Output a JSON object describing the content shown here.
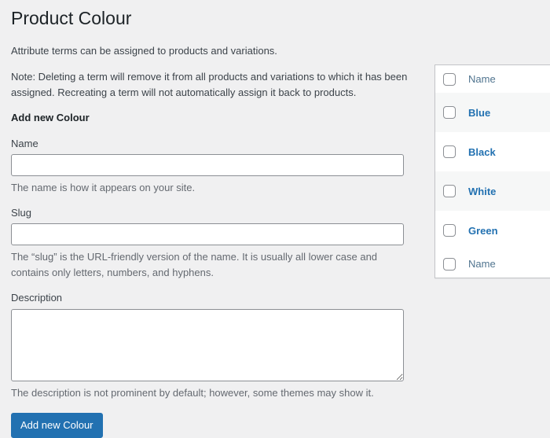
{
  "page": {
    "title": "Product Colour",
    "intro": "Attribute terms can be assigned to products and variations.",
    "note": "Note: Deleting a term will remove it from all products and variations to which it has been assigned. Recreating a term will not automatically assign it back to products.",
    "section_heading": "Add new Colour",
    "background_color": "#f0f0f1"
  },
  "form": {
    "name": {
      "label": "Name",
      "value": "",
      "placeholder": "",
      "help": "The name is how it appears on your site."
    },
    "slug": {
      "label": "Slug",
      "value": "",
      "placeholder": "",
      "help": "The “slug” is the URL-friendly version of the name. It is usually all lower case and contains only letters, numbers, and hyphens."
    },
    "description": {
      "label": "Description",
      "value": "",
      "placeholder": "",
      "help": "The description is not prominent by default; however, some themes may show it."
    },
    "submit": {
      "label": "Add new Colour",
      "color": "#2271b1"
    }
  },
  "terms_table": {
    "header": {
      "name_column": "Name"
    },
    "footer": {
      "name_column": "Name"
    },
    "rows": [
      {
        "name": "Blue",
        "checked": false
      },
      {
        "name": "Black",
        "checked": false
      },
      {
        "name": "White",
        "checked": false
      },
      {
        "name": "Green",
        "checked": false
      }
    ],
    "link_color": "#2271b1",
    "header_link_color": "#50748f"
  }
}
